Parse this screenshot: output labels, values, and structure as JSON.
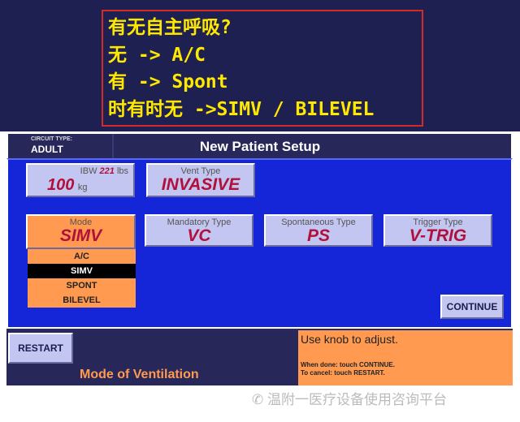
{
  "annotation": {
    "lines": [
      "有无自主呼吸?",
      "无 -> A/C",
      "有 -> Spont",
      "时有时无 ->SIMV / BILEVEL"
    ]
  },
  "header": {
    "circuit_type_label": "CIRCUIT TYPE:",
    "circuit_type": "ADULT",
    "title": "New Patient Setup"
  },
  "ibw": {
    "label": "IBW",
    "lbs_value": "221",
    "lbs_unit": "lbs",
    "kg_value": "100",
    "kg_unit": "kg"
  },
  "vent_type": {
    "label": "Vent Type",
    "value": "INVASIVE"
  },
  "mode": {
    "label": "Mode",
    "value": "SIMV",
    "options": [
      "A/C",
      "SIMV",
      "SPONT",
      "BILEVEL"
    ],
    "selected": "SIMV"
  },
  "mandatory_type": {
    "label": "Mandatory Type",
    "value": "VC"
  },
  "spontaneous_type": {
    "label": "Spontaneous Type",
    "value": "PS"
  },
  "trigger_type": {
    "label": "Trigger Type",
    "value": "V-TRIG"
  },
  "continue_label": "CONTINUE",
  "restart_label": "RESTART",
  "footer_title": "Mode of Ventilation",
  "help": {
    "main": "Use knob to adjust.",
    "line1": "When done: touch CONTINUE.",
    "line2": "To cancel: touch RESTART."
  },
  "watermark": "温附一医疗设备使用咨询平台",
  "colors": {
    "panel_blue": "#1525d8",
    "navy": "#27275a",
    "orange": "#ff9a50",
    "value_red": "#b0103a",
    "annotation_yellow": "#ffe800"
  }
}
